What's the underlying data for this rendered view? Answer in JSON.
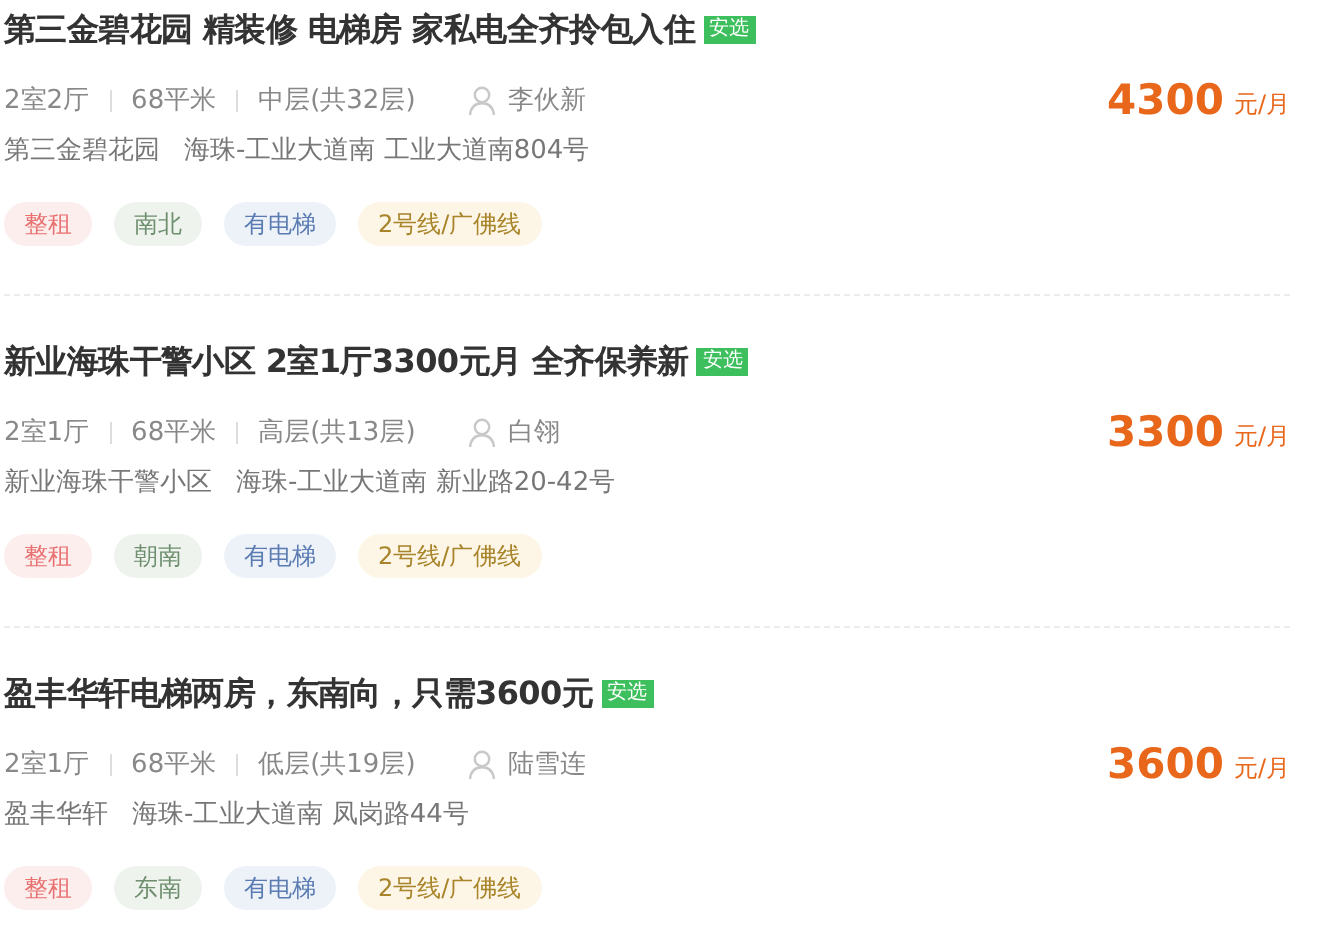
{
  "listings": [
    {
      "title": "第三金碧花园 精装修 电梯房 家私电全齐拎包入住",
      "badge": "安选",
      "layout": "2室2厅",
      "area": "68平米",
      "floor": "中层(共32层)",
      "agent": "李伙新",
      "community": "第三金碧花园",
      "address": "海珠-工业大道南 工业大道南804号",
      "price": "4300",
      "unit": "元/月",
      "tags": [
        {
          "kind": "rent",
          "label": "整租"
        },
        {
          "kind": "orientation",
          "label": "南北"
        },
        {
          "kind": "elevator",
          "label": "有电梯"
        },
        {
          "kind": "subway",
          "label": "2号线/广佛线"
        }
      ]
    },
    {
      "title": "新业海珠干警小区 2室1厅3300元月 全齐保养新",
      "badge": "安选",
      "layout": "2室1厅",
      "area": "68平米",
      "floor": "高层(共13层)",
      "agent": "白翎",
      "community": "新业海珠干警小区",
      "address": "海珠-工业大道南 新业路20-42号",
      "price": "3300",
      "unit": "元/月",
      "tags": [
        {
          "kind": "rent",
          "label": "整租"
        },
        {
          "kind": "orientation",
          "label": "朝南"
        },
        {
          "kind": "elevator",
          "label": "有电梯"
        },
        {
          "kind": "subway",
          "label": "2号线/广佛线"
        }
      ]
    },
    {
      "title": "盈丰华轩电梯两房，东南向，只需3600元",
      "badge": "安选",
      "layout": "2室1厅",
      "area": "68平米",
      "floor": "低层(共19层)",
      "agent": "陆雪连",
      "community": "盈丰华轩",
      "address": "海珠-工业大道南 凤岗路44号",
      "price": "3600",
      "unit": "元/月",
      "tags": [
        {
          "kind": "rent",
          "label": "整租"
        },
        {
          "kind": "orientation",
          "label": "东南"
        },
        {
          "kind": "elevator",
          "label": "有电梯"
        },
        {
          "kind": "subway",
          "label": "2号线/广佛线"
        }
      ]
    }
  ]
}
